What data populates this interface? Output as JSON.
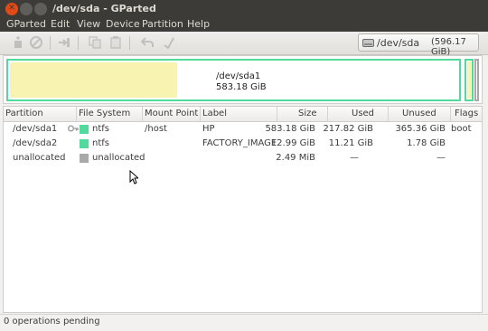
{
  "window": {
    "title": "/dev/sda - GParted"
  },
  "menu": [
    "GParted",
    "Edit",
    "View",
    "Device",
    "Partition",
    "Help"
  ],
  "toolbar": {
    "icons": [
      "new-icon",
      "delete-icon",
      "resize-move-icon",
      "copy-icon",
      "paste-icon",
      "undo-icon",
      "apply-icon"
    ],
    "device_name": "/dev/sda",
    "device_size": "(596.17 GiB)"
  },
  "partition_map": {
    "selected_label": "/dev/sda1",
    "selected_size": "583.18 GiB",
    "used_fraction": 0.3735,
    "colors": {
      "ntfs": "#52d99c",
      "unallocated": "#a9a9a9",
      "used": "#f8f3b0"
    }
  },
  "table": {
    "headers": [
      "Partition",
      "File System",
      "Mount Point",
      "Label",
      "Size",
      "Used",
      "Unused",
      "Flags"
    ],
    "rows": [
      {
        "partition": "/dev/sda1",
        "fs": "ntfs",
        "fs_color": "#52d99c",
        "mount": "/host",
        "label": "HP",
        "size": "583.18 GiB",
        "used": "217.82 GiB",
        "unused": "365.36 GiB",
        "flags": "boot",
        "mounted": true
      },
      {
        "partition": "/dev/sda2",
        "fs": "ntfs",
        "fs_color": "#52d99c",
        "mount": "",
        "label": "FACTORY_IMAGE",
        "size": "12.99 GiB",
        "used": "11.21 GiB",
        "unused": "1.78 GiB",
        "flags": "",
        "mounted": false
      },
      {
        "partition": "unallocated",
        "fs": "unallocated",
        "fs_color": "#a9a9a9",
        "mount": "",
        "label": "",
        "size": "2.49 MiB",
        "used": "—",
        "unused": "—",
        "flags": "",
        "mounted": false
      }
    ]
  },
  "status": {
    "text": "0 operations pending"
  }
}
